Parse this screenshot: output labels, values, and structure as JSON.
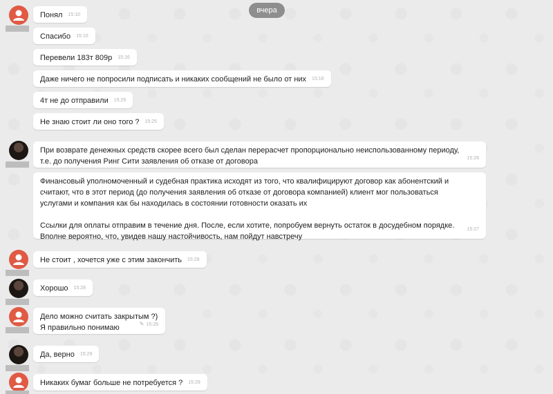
{
  "date_divider": "вчера",
  "messages": [
    {
      "text": "Понял",
      "time": "15:10"
    },
    {
      "text": "Спасибо",
      "time": "15:10"
    },
    {
      "text": "Перевели 183т 809р",
      "time": "15:16"
    },
    {
      "text": "Даже ничего не попросили подписать и никаких сообщений не было от них",
      "time": "15:16"
    },
    {
      "text": "4т не до отправили",
      "time": "15:25"
    },
    {
      "text": "Не знаю стоит ли оно того ?",
      "time": "15:25"
    },
    {
      "lines": [
        "При возврате денежных средств скорее всего был сделан перерасчет пропорционально неиспользованному периоду,",
        "т.е. до получения Ринг Сити заявления об отказе от договора"
      ],
      "time": "15:26"
    },
    {
      "lines": [
        "Финансовый уполномоченный и судебная практика исходят из того, что квалифицируют договор как абонентский и",
        "считают, что в этот период (до получения заявления об отказе от договора компанией) клиент мог пользоваться",
        "услугами и компания как бы находилась в состоянии готовности оказать их",
        "",
        "Ссылки для оплаты отправим в течение дня. После, если хотите, попробуем вернуть остаток в досудебном порядке.",
        "Вполне вероятно, что, увидев нашу настойчивость, нам пойдут навстречу"
      ],
      "time": "15:27"
    },
    {
      "text": "Не стоит , хочется уже с этим закончить",
      "time": "15:28"
    },
    {
      "text": "Хорошо",
      "time": "15:28"
    },
    {
      "lines": [
        "Дело можно считать закрытым ?)",
        "Я правильно понимаю"
      ],
      "time": "15:28",
      "edited_icon": "pencil-icon"
    },
    {
      "text": "Да, верно",
      "time": "15:29"
    },
    {
      "text": "Никаких бумаг больше не потребуется ?",
      "time": "15:29"
    }
  ]
}
